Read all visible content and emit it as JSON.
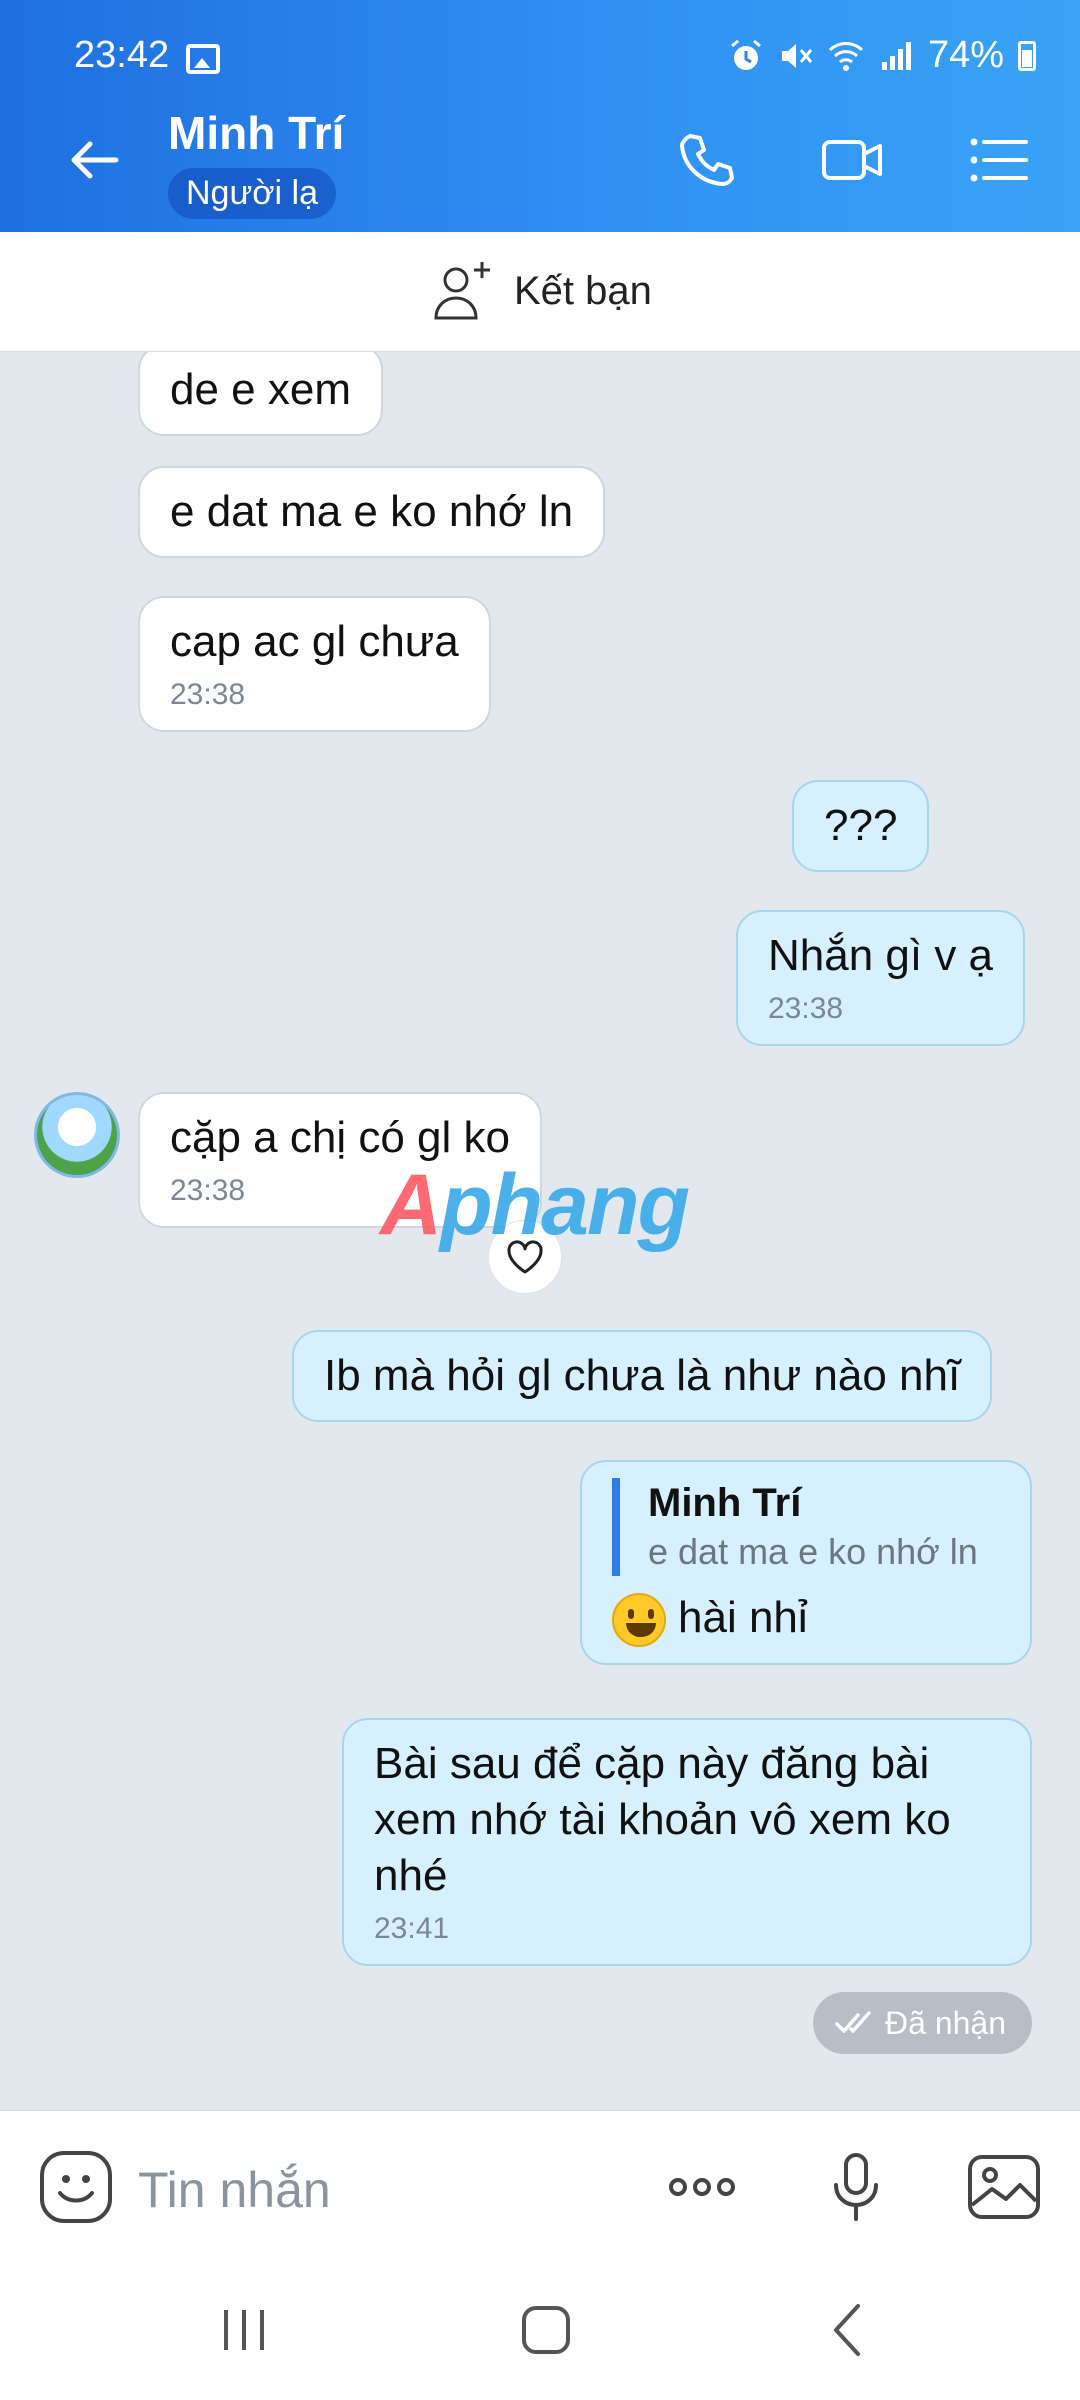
{
  "status": {
    "time": "23:42",
    "battery": "74%"
  },
  "header": {
    "name": "Minh Trí",
    "badge": "Người lạ"
  },
  "add_friend": {
    "label": "Kết bạn"
  },
  "messages": [
    {
      "text": "de e xem"
    },
    {
      "text": "e dat ma e ko nhớ ln"
    },
    {
      "text": "cap ac gl chưa",
      "time": "23:38"
    },
    {
      "text": "???"
    },
    {
      "text": "Nhắn gì v ạ",
      "time": "23:38"
    },
    {
      "text": "cặp a chị có gl ko",
      "time": "23:38"
    },
    {
      "text": "Ib mà hỏi gl chưa là như nào nhĩ"
    },
    {
      "quote_name": "Minh Trí",
      "quote_text": "e dat ma e ko nhớ ln",
      "text": "hài nhỉ"
    },
    {
      "text": "Bài sau để cặp này đăng bài xem nhớ tài khoản vô xem ko nhé",
      "time": "23:41"
    }
  ],
  "receipt": "Đã nhận",
  "watermark": {
    "part1": "A",
    "part2": "phang"
  },
  "input": {
    "placeholder": "Tin nhắn"
  },
  "colors": {
    "header_start": "#1f6fe0",
    "header_end": "#39a3f6",
    "out_bubble": "#d6f0fd",
    "in_bubble": "#ffffff",
    "chat_bg": "#e3e8ef"
  },
  "icons": [
    "gallery-icon",
    "alarm-icon",
    "mute-icon",
    "wifi-icon",
    "signal-icon",
    "battery-icon",
    "back-arrow-icon",
    "phone-icon",
    "video-call-icon",
    "menu-icon",
    "add-friend-icon",
    "heart-icon",
    "sticker-icon",
    "more-icon",
    "microphone-icon",
    "image-icon",
    "recent-apps-icon",
    "home-icon",
    "nav-back-icon"
  ]
}
